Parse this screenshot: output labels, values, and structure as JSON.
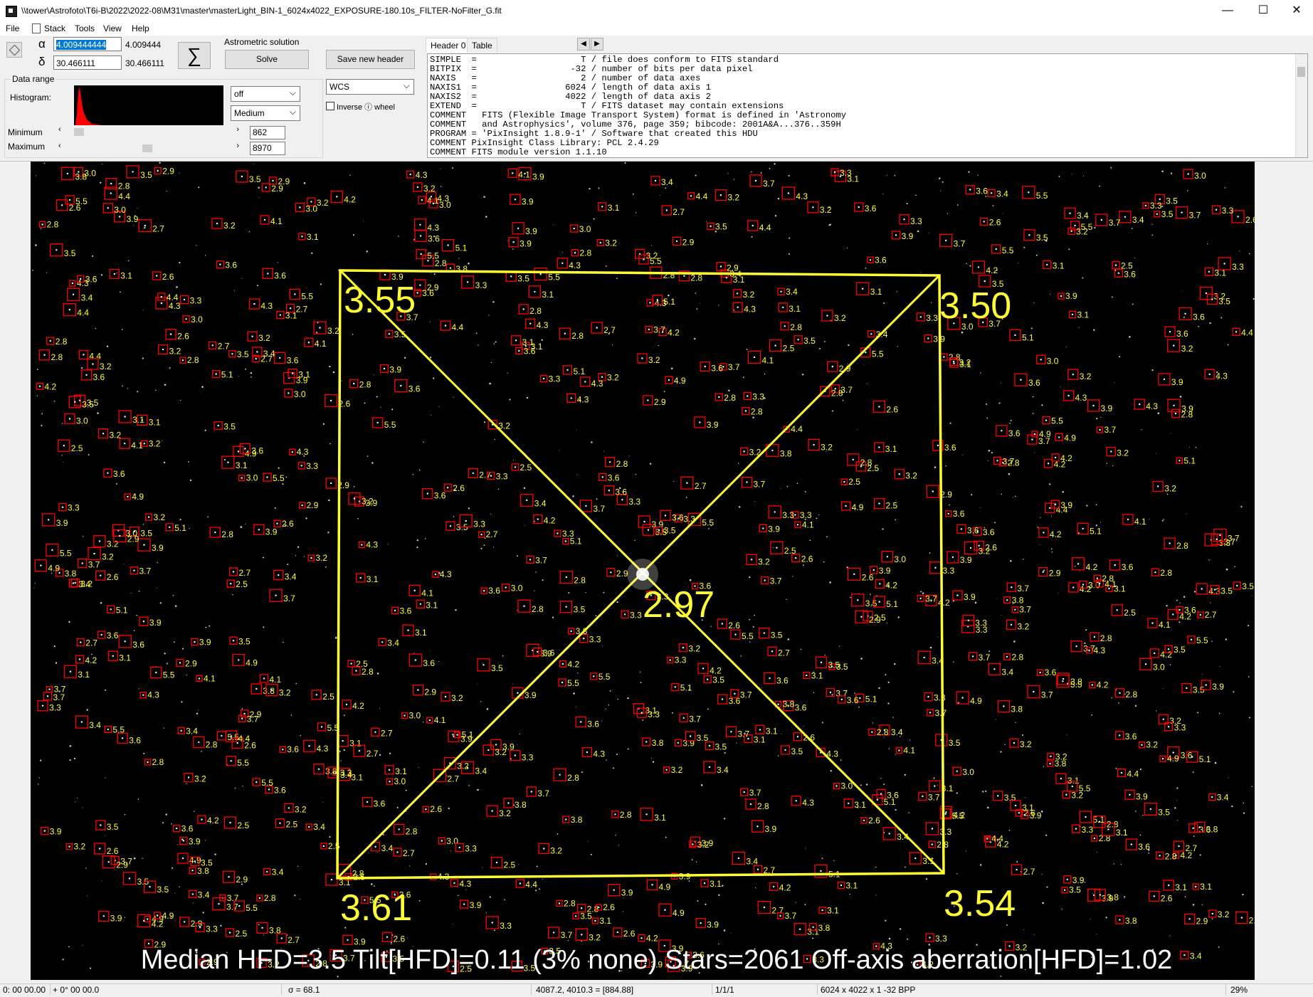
{
  "window": {
    "title": "\\\\tower\\Astrofoto\\T6i-B\\2022\\2022-08\\M31\\master\\masterLight_BIN-1_6024x4022_EXPOSURE-180.10s_FILTER-NoFilter_G.fit",
    "minimize": "—",
    "maximize": "☐",
    "close": "✕"
  },
  "menu": {
    "file": "File",
    "stack": "Stack",
    "tools": "Tools",
    "view": "View",
    "help": "Help"
  },
  "coords": {
    "alpha_symbol": "α",
    "delta_symbol": "δ",
    "alpha_input": "4.009444444",
    "alpha_value": "4.009444",
    "delta_input": "30.466111",
    "delta_value": "30.466111",
    "sum_symbol": "∑"
  },
  "astrometric": {
    "group_label": "Astrometric solution",
    "solve_label": "Solve",
    "save_header_label": "Save new header"
  },
  "data_range": {
    "group_label": "Data range",
    "histogram_label": "Histogram:",
    "minimum_label": "Minimum",
    "maximum_label": "Maximum",
    "minimum_value": "862",
    "maximum_value": "8970",
    "stretch_select": "off",
    "quality_select": "Medium",
    "wcs_select": "WCS",
    "inverse_label": "Inverse ⓘ wheel"
  },
  "tabs": {
    "header0": "Header 0",
    "table": "Table"
  },
  "fits_header": "SIMPLE  =                    T / file does conform to FITS standard\nBITPIX  =                  -32 / number of bits per data pixel\nNAXIS   =                    2 / number of data axes\nNAXIS1  =                 6024 / length of data axis 1\nNAXIS2  =                 4022 / length of data axis 2\nEXTEND  =                    T / FITS dataset may contain extensions\nCOMMENT   FITS (Flexible Image Transport System) format is defined in 'Astronomy\nCOMMENT   and Astrophysics', volume 376, page 359; bibcode: 2001A&A...376..359H\nPROGRAM = 'PixInsight 1.8.9-1' / Software that created this HDU\nCOMMENT PixInsight Class Library: PCL 2.4.29\nCOMMENT FITS module version 1.1.10",
  "analysis": {
    "corner_tl": "3.55",
    "corner_tr": "3.50",
    "corner_bl": "3.61",
    "corner_br": "3.54",
    "center": "2.97",
    "summary": "Median HFD=3.5  Tilt[HFD]=0.11 (3% none)  Stars=2061  Off-axis aberration[HFD]=1.02",
    "star_labels": [
      "3.9",
      "5.5",
      "3.7",
      "3.2",
      "2.8",
      "3.5",
      "3.1",
      "4.2",
      "3.6",
      "3.4",
      "2.9",
      "3.3",
      "3.0",
      "4.1",
      "2.7",
      "3.8",
      "4.4",
      "2.6",
      "5.1",
      "3.5",
      "3.2",
      "2.8",
      "3.7",
      "4.9",
      "3.1",
      "3.3",
      "2.5",
      "3.6",
      "3.9",
      "4.3"
    ],
    "overlay_color": "#ffff33",
    "box_color": "#ff0000"
  },
  "status": {
    "cursor_pos": "0: 00  00.00",
    "cursor_dec": "+ 0° 00  00.0",
    "sigma": "σ = 68.1",
    "pixel": "4087.2, 4010.3 = [884.88]",
    "frames": "1/1/1",
    "dims": "6024 x 4022 x 1   -32 BPP",
    "zoom": "29%"
  }
}
